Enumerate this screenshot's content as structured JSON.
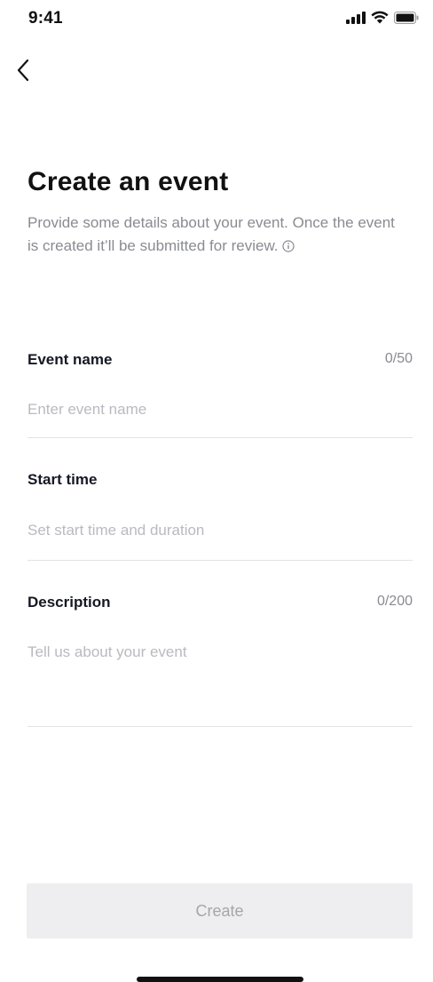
{
  "status_bar": {
    "time": "9:41",
    "icons": [
      "cellular-signal-icon",
      "wifi-icon",
      "battery-icon"
    ]
  },
  "nav": {
    "back_icon": "chevron-left-icon"
  },
  "header": {
    "title": "Create an event",
    "subtitle": "Provide some details about your event. Once the event is created it’ll be submitted for review.",
    "info_icon": "info-icon"
  },
  "form": {
    "event_name": {
      "label": "Event name",
      "counter": "0/50",
      "value": "",
      "placeholder": "Enter event name"
    },
    "start_time": {
      "label": "Start time",
      "value": "",
      "placeholder": "Set start time and duration"
    },
    "description": {
      "label": "Description",
      "counter": "0/200",
      "value": "",
      "placeholder": "Tell us about your event"
    }
  },
  "actions": {
    "create_label": "Create"
  },
  "colors": {
    "text_primary": "#161823",
    "text_secondary": "#8a8b91",
    "placeholder": "#b9bac0",
    "divider": "#e3e3e5",
    "button_disabled_bg": "#eeeef0",
    "button_disabled_text": "#a5a6ab"
  }
}
